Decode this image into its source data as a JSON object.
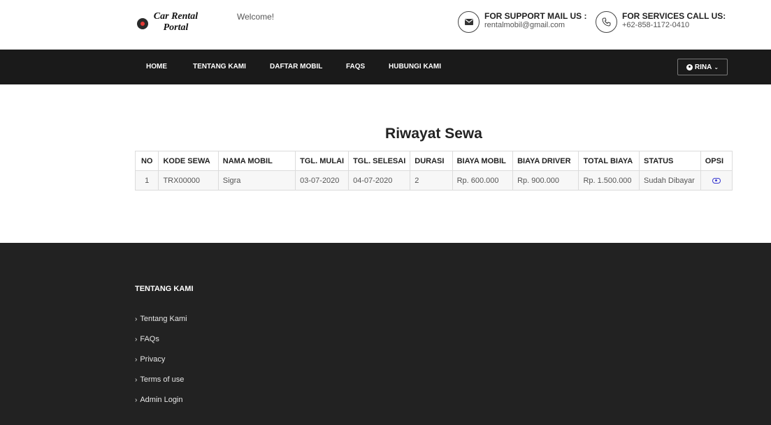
{
  "header": {
    "logo_line1": "Car Rental",
    "logo_line2": "Portal",
    "welcome": "Welcome!",
    "support": {
      "title": "FOR SUPPORT MAIL US :",
      "value": "rentalmobil@gmail.com",
      "icon": "envelope-icon"
    },
    "services": {
      "title": "FOR SERVICES CALL US:",
      "value": "+62-858-1172-0410",
      "icon": "phone-icon"
    }
  },
  "nav": {
    "items": [
      "HOME",
      "TENTANG KAMI",
      "DAFTAR MOBIL",
      "FAQS",
      "HUBUNGI KAMI"
    ],
    "user": "RINA"
  },
  "main": {
    "title": "Riwayat Sewa",
    "table": {
      "headers": [
        "NO",
        "KODE SEWA",
        "NAMA MOBIL",
        "TGL. MULAI",
        "TGL. SELESAI",
        "DURASI",
        "BIAYA MOBIL",
        "BIAYA DRIVER",
        "TOTAL BIAYA",
        "STATUS",
        "OPSI"
      ],
      "rows": [
        [
          "1",
          "TRX00000",
          "Sigra",
          "03-07-2020",
          "04-07-2020",
          "2",
          "Rp. 600.000",
          "Rp. 900.000",
          "Rp. 1.500.000",
          "Sudah Dibayar"
        ]
      ]
    }
  },
  "footer": {
    "heading": "TENTANG KAMI",
    "links": [
      "Tentang Kami",
      "FAQs",
      "Privacy",
      "Terms of use",
      "Admin Login"
    ]
  },
  "colors": {
    "nav_bg": "#1a1a1a",
    "footer_bg": "#222222",
    "eye_icon": "#3b3bd1"
  }
}
